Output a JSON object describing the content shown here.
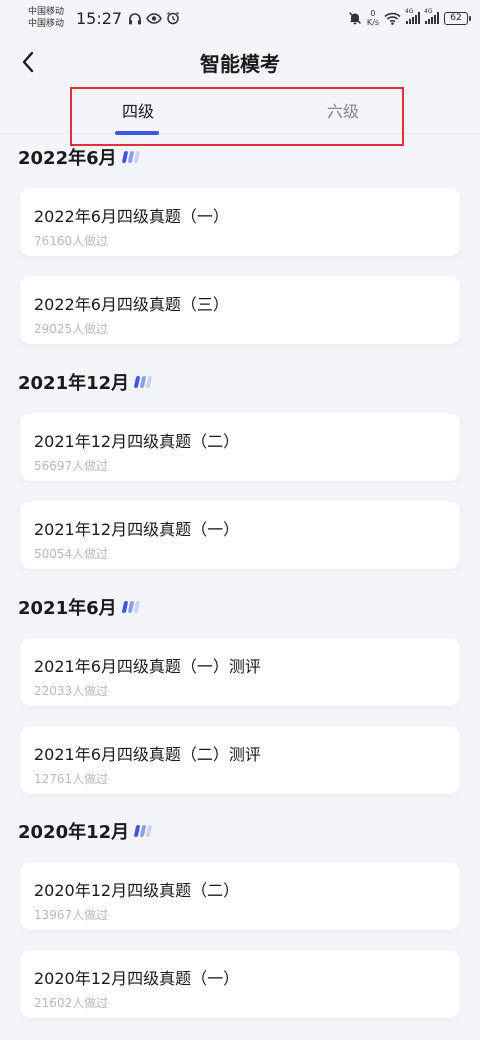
{
  "status_bar": {
    "carrier_1": "中国移动",
    "carrier_2": "中国移动",
    "time": "15:27",
    "net_speed_value": "0",
    "net_speed_unit": "K/s",
    "signal_1_label": "4G",
    "signal_2_label": "4G",
    "battery": "62"
  },
  "header": {
    "title": "智能模考"
  },
  "tabs": [
    {
      "label": "四级",
      "active": true
    },
    {
      "label": "六级",
      "active": false
    }
  ],
  "accent_color": "#3b57e8",
  "highlight_color": "#e0303d",
  "sections": [
    {
      "title": "2022年6月",
      "items": [
        {
          "title": "2022年6月四级真题（一）",
          "count": "76160人做过"
        },
        {
          "title": "2022年6月四级真题（三）",
          "count": "29025人做过"
        }
      ]
    },
    {
      "title": "2021年12月",
      "items": [
        {
          "title": "2021年12月四级真题（二）",
          "count": "56697人做过"
        },
        {
          "title": "2021年12月四级真题（一）",
          "count": "50054人做过"
        }
      ]
    },
    {
      "title": "2021年6月",
      "items": [
        {
          "title": "2021年6月四级真题（一）测评",
          "count": "22033人做过"
        },
        {
          "title": "2021年6月四级真题（二）测评",
          "count": "12761人做过"
        }
      ]
    },
    {
      "title": "2020年12月",
      "items": [
        {
          "title": "2020年12月四级真题（二）",
          "count": "13967人做过"
        },
        {
          "title": "2020年12月四级真题（一）",
          "count": "21602人做过"
        }
      ]
    }
  ]
}
